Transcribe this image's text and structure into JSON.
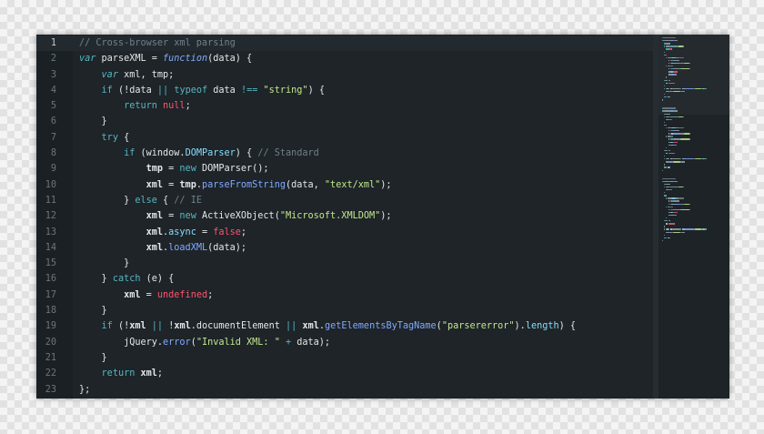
{
  "editor": {
    "colors": {
      "background": "#1e2428",
      "comment": "#6f8187",
      "keyword": "#56b6c2",
      "string": "#c3e88d",
      "literal": "#ff5370",
      "method": "#82aaff",
      "text": "#e4e8ea"
    },
    "active_line": 1,
    "lines": [
      {
        "num": "1",
        "tokens": [
          {
            "t": "cm",
            "v": "// Cross-browser xml parsing"
          }
        ]
      },
      {
        "num": "2",
        "tokens": [
          {
            "t": "it",
            "v": "var"
          },
          {
            "t": "pl",
            "v": " parseXML = "
          },
          {
            "t": "ct",
            "v": "function"
          },
          {
            "t": "pl",
            "v": "(data) {"
          }
        ]
      },
      {
        "num": "3",
        "tokens": [
          {
            "t": "pl",
            "v": "    "
          },
          {
            "t": "it",
            "v": "var"
          },
          {
            "t": "pl",
            "v": " xml, tmp;"
          }
        ]
      },
      {
        "num": "4",
        "tokens": [
          {
            "t": "pl",
            "v": "    "
          },
          {
            "t": "kw",
            "v": "if"
          },
          {
            "t": "pl",
            "v": " (!data "
          },
          {
            "t": "kw",
            "v": "||"
          },
          {
            "t": "pl",
            "v": " "
          },
          {
            "t": "kw",
            "v": "typeof"
          },
          {
            "t": "pl",
            "v": " data "
          },
          {
            "t": "kw",
            "v": "!=="
          },
          {
            "t": "pl",
            "v": " "
          },
          {
            "t": "st",
            "v": "\"string\""
          },
          {
            "t": "pl",
            "v": ") {"
          }
        ]
      },
      {
        "num": "5",
        "tokens": [
          {
            "t": "pl",
            "v": "        "
          },
          {
            "t": "kw",
            "v": "return"
          },
          {
            "t": "pl",
            "v": " "
          },
          {
            "t": "nu",
            "v": "null"
          },
          {
            "t": "pl",
            "v": ";"
          }
        ]
      },
      {
        "num": "6",
        "tokens": [
          {
            "t": "pl",
            "v": "    }"
          }
        ]
      },
      {
        "num": "7",
        "tokens": [
          {
            "t": "pl",
            "v": "    "
          },
          {
            "t": "kw",
            "v": "try"
          },
          {
            "t": "pl",
            "v": " {"
          }
        ]
      },
      {
        "num": "8",
        "tokens": [
          {
            "t": "pl",
            "v": "        "
          },
          {
            "t": "kw",
            "v": "if"
          },
          {
            "t": "pl",
            "v": " (window."
          },
          {
            "t": "pr",
            "v": "DOMParser"
          },
          {
            "t": "pl",
            "v": ") { "
          },
          {
            "t": "cm",
            "v": "// Standard"
          }
        ]
      },
      {
        "num": "9",
        "tokens": [
          {
            "t": "pl",
            "v": "            "
          },
          {
            "t": "id",
            "v": "tmp"
          },
          {
            "t": "pl",
            "v": " = "
          },
          {
            "t": "kw",
            "v": "new"
          },
          {
            "t": "pl",
            "v": " DOMParser();"
          }
        ]
      },
      {
        "num": "10",
        "tokens": [
          {
            "t": "pl",
            "v": "            "
          },
          {
            "t": "id",
            "v": "xml"
          },
          {
            "t": "pl",
            "v": " = "
          },
          {
            "t": "id",
            "v": "tmp"
          },
          {
            "t": "pl",
            "v": "."
          },
          {
            "t": "fn",
            "v": "parseFromString"
          },
          {
            "t": "pl",
            "v": "(data, "
          },
          {
            "t": "st",
            "v": "\"text/xml\""
          },
          {
            "t": "pl",
            "v": ");"
          }
        ]
      },
      {
        "num": "11",
        "tokens": [
          {
            "t": "pl",
            "v": "        } "
          },
          {
            "t": "kw",
            "v": "else"
          },
          {
            "t": "pl",
            "v": " { "
          },
          {
            "t": "cm",
            "v": "// IE"
          }
        ]
      },
      {
        "num": "12",
        "tokens": [
          {
            "t": "pl",
            "v": "            "
          },
          {
            "t": "id",
            "v": "xml"
          },
          {
            "t": "pl",
            "v": " = "
          },
          {
            "t": "kw",
            "v": "new"
          },
          {
            "t": "pl",
            "v": " ActiveXObject("
          },
          {
            "t": "st",
            "v": "\"Microsoft.XMLDOM\""
          },
          {
            "t": "pl",
            "v": ");"
          }
        ]
      },
      {
        "num": "13",
        "tokens": [
          {
            "t": "pl",
            "v": "            "
          },
          {
            "t": "id",
            "v": "xml"
          },
          {
            "t": "pl",
            "v": "."
          },
          {
            "t": "pr",
            "v": "async"
          },
          {
            "t": "pl",
            "v": " = "
          },
          {
            "t": "nu",
            "v": "false"
          },
          {
            "t": "pl",
            "v": ";"
          }
        ]
      },
      {
        "num": "14",
        "tokens": [
          {
            "t": "pl",
            "v": "            "
          },
          {
            "t": "id",
            "v": "xml"
          },
          {
            "t": "pl",
            "v": "."
          },
          {
            "t": "fn",
            "v": "loadXML"
          },
          {
            "t": "pl",
            "v": "(data);"
          }
        ]
      },
      {
        "num": "15",
        "tokens": [
          {
            "t": "pl",
            "v": "        }"
          }
        ]
      },
      {
        "num": "16",
        "tokens": [
          {
            "t": "pl",
            "v": "    } "
          },
          {
            "t": "kw",
            "v": "catch"
          },
          {
            "t": "pl",
            "v": " (e) {"
          }
        ]
      },
      {
        "num": "17",
        "tokens": [
          {
            "t": "pl",
            "v": "        "
          },
          {
            "t": "id",
            "v": "xml"
          },
          {
            "t": "pl",
            "v": " = "
          },
          {
            "t": "nu",
            "v": "undefined"
          },
          {
            "t": "pl",
            "v": ";"
          }
        ]
      },
      {
        "num": "18",
        "tokens": [
          {
            "t": "pl",
            "v": "    }"
          }
        ]
      },
      {
        "num": "19",
        "tokens": [
          {
            "t": "pl",
            "v": "    "
          },
          {
            "t": "kw",
            "v": "if"
          },
          {
            "t": "pl",
            "v": " (!"
          },
          {
            "t": "id",
            "v": "xml"
          },
          {
            "t": "pl",
            "v": " "
          },
          {
            "t": "kw",
            "v": "||"
          },
          {
            "t": "pl",
            "v": " !"
          },
          {
            "t": "id",
            "v": "xml"
          },
          {
            "t": "pl",
            "v": ".documentElement "
          },
          {
            "t": "kw",
            "v": "||"
          },
          {
            "t": "pl",
            "v": " "
          },
          {
            "t": "id",
            "v": "xml"
          },
          {
            "t": "pl",
            "v": "."
          },
          {
            "t": "fn",
            "v": "getElementsByTagName"
          },
          {
            "t": "pl",
            "v": "("
          },
          {
            "t": "st",
            "v": "\"parsererror\""
          },
          {
            "t": "pl",
            "v": ")."
          },
          {
            "t": "pr",
            "v": "length"
          },
          {
            "t": "pl",
            "v": ") {"
          }
        ]
      },
      {
        "num": "20",
        "tokens": [
          {
            "t": "pl",
            "v": "        jQuery."
          },
          {
            "t": "fn",
            "v": "error"
          },
          {
            "t": "pl",
            "v": "("
          },
          {
            "t": "st",
            "v": "\"Invalid XML: \""
          },
          {
            "t": "pl",
            "v": " "
          },
          {
            "t": "kw",
            "v": "+"
          },
          {
            "t": "pl",
            "v": " data);"
          }
        ]
      },
      {
        "num": "21",
        "tokens": [
          {
            "t": "pl",
            "v": "    }"
          }
        ]
      },
      {
        "num": "22",
        "tokens": [
          {
            "t": "pl",
            "v": "    "
          },
          {
            "t": "kw",
            "v": "return"
          },
          {
            "t": "pl",
            "v": " "
          },
          {
            "t": "id",
            "v": "xml"
          },
          {
            "t": "pl",
            "v": ";"
          }
        ]
      },
      {
        "num": "23",
        "tokens": [
          {
            "t": "pl",
            "v": "};"
          }
        ]
      }
    ]
  }
}
